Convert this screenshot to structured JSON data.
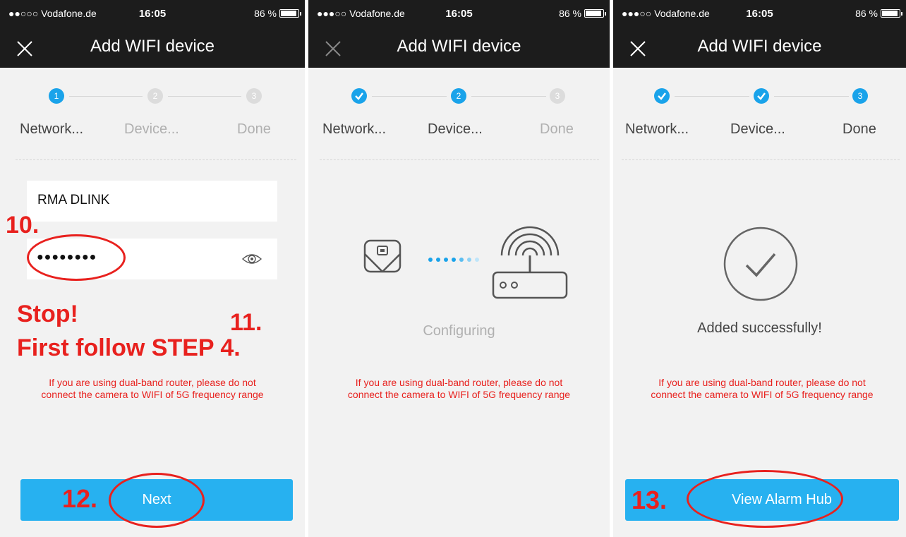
{
  "status_bar": {
    "carrier": "●●○○○ Vodafone.de",
    "carrier_alt": "●●●○○ Vodafone.de",
    "time": "16:05",
    "battery": "86 %"
  },
  "nav": {
    "title": "Add WIFI device"
  },
  "steps": {
    "labels": [
      "Network...",
      "Device...",
      "Done"
    ],
    "numbers": [
      "1",
      "2",
      "3"
    ]
  },
  "panel1": {
    "wifi_name": "RMA DLINK",
    "password_masked": "●●●●●●●●",
    "warning": "If you are using dual-band router, please do not connect the camera to WIFI of 5G frequency range",
    "next_button": "Next",
    "annotations": {
      "step10": "10.",
      "stop": "Stop!",
      "step11": "11.",
      "follow": "First follow STEP 4.",
      "step12": "12."
    }
  },
  "panel2": {
    "status": "Configuring",
    "warning": "If you are using dual-band router, please do not connect the camera to WIFI of 5G frequency range"
  },
  "panel3": {
    "status": "Added successfully!",
    "warning": "If you are using dual-band router, please do not connect the camera to WIFI of 5G frequency range",
    "view_button": "View Alarm Hub",
    "annotations": {
      "step13": "13."
    }
  },
  "colors": {
    "accent": "#1aa3ea",
    "button": "#27b1f0",
    "annotation_red": "#e8211e",
    "header": "#1c1c1c"
  }
}
